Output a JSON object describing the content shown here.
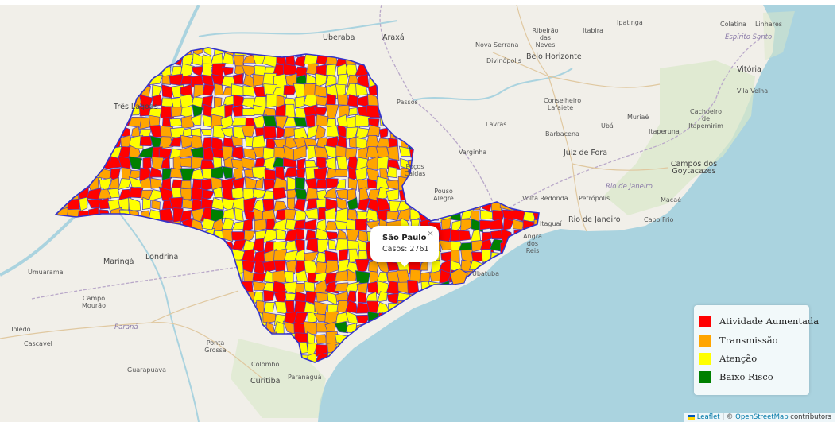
{
  "popup": {
    "title": "São Paulo",
    "cases_text": "Casos: 2761",
    "close_glyph": "×"
  },
  "legend": {
    "items": [
      {
        "label": "Atividade Aumentada",
        "color": "#ff0000"
      },
      {
        "label": "Transmissão",
        "color": "#ffa500"
      },
      {
        "label": "Atenção",
        "color": "#ffff00"
      },
      {
        "label": "Baixo Risco",
        "color": "#008000"
      }
    ]
  },
  "attribution": {
    "leaflet": "Leaflet",
    "separator": " | © ",
    "osm": "OpenStreetMap",
    "contributors": " contributors",
    "flag_icon": "ukraine-flag-icon"
  },
  "places": {
    "uberaba": "Uberaba",
    "araxa": "Araxá",
    "nova_serrana": "Nova Serrana",
    "ribeirao_das_neves": "Ribeirão das Neves",
    "itabira": "Itabira",
    "ipatinga": "Ipatinga",
    "colatina": "Colatina",
    "linhares": "Linhares",
    "espirito_santo": "Espírito Santo",
    "divinopolis": "Divinópolis",
    "belo_horizonte": "Belo Horizonte",
    "vitoria": "Vitória",
    "vila_velha": "Vila Velha",
    "tres_lagoas": "Três Lagoas",
    "passos": "Passos",
    "conselheiro_lafaiete": "Conselheiro Lafaiete",
    "lavras": "Lavras",
    "uba": "Ubá",
    "muriae": "Muriaé",
    "cachoeiro": "Cachoeiro de Itapemirim",
    "barbacena": "Barbacena",
    "itaperuna": "Itaperuna",
    "varginha": "Varginha",
    "juiz_de_fora": "Juiz de Fora",
    "campos": "Campos dos Goytacazes",
    "pocos_caldas": "Poços Caldas",
    "rio_de_janeiro_state": "Rio de Janeiro",
    "pouso_alegre": "Pouso Alegre",
    "volta_redonda": "Volta Redonda",
    "petropolis": "Petrópolis",
    "macae": "Macaé",
    "rio_de_janeiro": "Rio de Janeiro",
    "cabo_frio": "Cabo Frio",
    "itaguai": "Itaguaí",
    "angra_dos_reis": "Angra dos Reis",
    "maringa": "Maringá",
    "londrina": "Londrina",
    "umuarama": "Umuarama",
    "campo_mourao": "Campo Mourão",
    "parana": "Paraná",
    "toledo": "Toledo",
    "cascavel": "Cascavel",
    "ponta_grossa": "Ponta Grossa",
    "guarapuava": "Guarapuava",
    "colombo": "Colombo",
    "curitiba": "Curitiba",
    "paranagua": "Paranaguá",
    "ubatuba": "Ubatuba"
  }
}
